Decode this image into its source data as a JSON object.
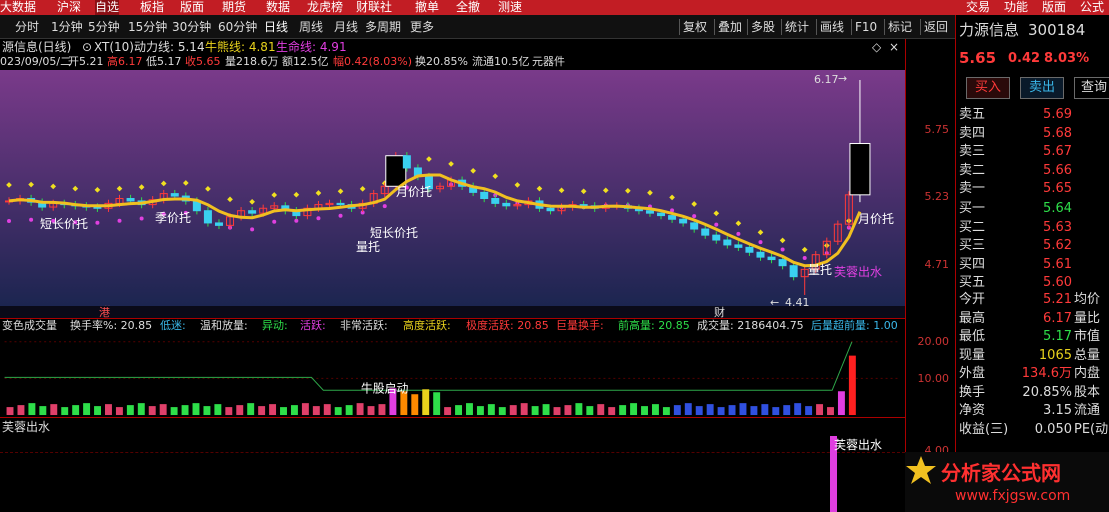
{
  "menu": [
    "大数据",
    "沪深",
    "自选",
    "板指",
    "版面",
    "期货",
    "数据",
    "龙虎榜",
    "财联社",
    "撤单",
    "全撤",
    "测速"
  ],
  "menu_right": [
    "交易",
    "功能",
    "版面",
    "公式"
  ],
  "toolbar_left": [
    "分时",
    "1分钟",
    "5分钟",
    "15分钟",
    "30分钟",
    "60分钟",
    "日线",
    "周线",
    "月线",
    "多周期",
    "更多"
  ],
  "toolbar_right": [
    "复权",
    "叠加",
    "多股",
    "统计",
    "画线",
    "F10",
    "标记",
    "返回"
  ],
  "info1": {
    "name": "源信息(日线)",
    "xt": "XT(10)",
    "dongli": "动力线: 5.14",
    "niu": "牛熊线: 4.81",
    "sheng": "生命线: 4.91"
  },
  "info2": {
    "date": "023/09/05/二",
    "open": "开5.21",
    "high": "高6.17",
    "low": "低5.17",
    "close": "收5.65",
    "vol": "量218.6万",
    "amt": "额12.5亿",
    "amp": "幅0.42(8.03%)",
    "turn": "换20.85%",
    "float": "流通10.5亿",
    "sector": "元器件"
  },
  "yaxis": {
    "p1": "5.75",
    "p2": "5.23",
    "p3": "4.71",
    "v1": "20.00",
    "v2": "10.00",
    "i1": "4.00"
  },
  "chart_labels": {
    "hi": "6.17",
    "lo": "4.41",
    "a1": "短长价托",
    "a2": "季价托",
    "a3": "短长价托",
    "a4": "量托",
    "a5": "月价托",
    "a6": "量托",
    "a7": "芙蓉出水",
    "a8": "月价托",
    "gang": "港",
    "cai": "财",
    "niudong": "牛股启动"
  },
  "volhead": {
    "title": "变色成交量",
    "turn": "换手率%: 20.85",
    "low": "低迷:",
    "mid": "温和放量:",
    "yd": "异动:",
    "hy": "活跃:",
    "fhy": "非常活跃:",
    "gd": "高度活跃:",
    "jd": "极度活跃: 20.85",
    "jl": "巨量换手:",
    "qg": "前高量: 20.85",
    "cj": "成交量: 2186404.75",
    "hl": "后量超前量: 1.00"
  },
  "ind": {
    "title": "芙蓉出水",
    "label": "芙蓉出水"
  },
  "stock": {
    "name": "力源信息",
    "code": "300184",
    "price": "5.65",
    "chg": "0.42",
    "pct": "8.03%",
    "buy": "买入",
    "sell": "卖出",
    "query": "查询"
  },
  "asks": [
    {
      "l": "卖五",
      "p": "5.69"
    },
    {
      "l": "卖四",
      "p": "5.68"
    },
    {
      "l": "卖三",
      "p": "5.67"
    },
    {
      "l": "卖二",
      "p": "5.66"
    },
    {
      "l": "卖一",
      "p": "5.65"
    }
  ],
  "bids": [
    {
      "l": "买一",
      "p": "5.64"
    },
    {
      "l": "买二",
      "p": "5.63"
    },
    {
      "l": "买三",
      "p": "5.62"
    },
    {
      "l": "买四",
      "p": "5.61"
    },
    {
      "l": "买五",
      "p": "5.60"
    }
  ],
  "stats": [
    {
      "l": "今开",
      "v": "5.21",
      "l2": "均价"
    },
    {
      "l": "最高",
      "v": "6.17",
      "l2": "量比"
    },
    {
      "l": "最低",
      "v": "5.17",
      "l2": "市值"
    },
    {
      "l": "现量",
      "v": "1065",
      "l2": "总量"
    },
    {
      "l": "外盘",
      "v": "134.6万",
      "l2": "内盘"
    },
    {
      "l": "换手",
      "v": "20.85%",
      "l2": "股本"
    },
    {
      "l": "净资",
      "v": "3.15",
      "l2": "流通"
    },
    {
      "l": "收益(三)",
      "v": "0.050",
      "l2": "PE(动"
    }
  ],
  "watermark": {
    "title": "分析家公式网",
    "url": "www.fxjgsw.com"
  },
  "chart_data": {
    "type": "candlestick",
    "high": 6.17,
    "low": 4.41,
    "indicator_vol_last": 20.85,
    "indicator_ind_last": 4.0
  },
  "colors": {
    "menubar": "#c21d24",
    "up": "#ff3a3a",
    "down": "#2ede4a",
    "ma": "#f0c020",
    "dot_y": "#f0e020",
    "dot_m": "#e040e0"
  }
}
